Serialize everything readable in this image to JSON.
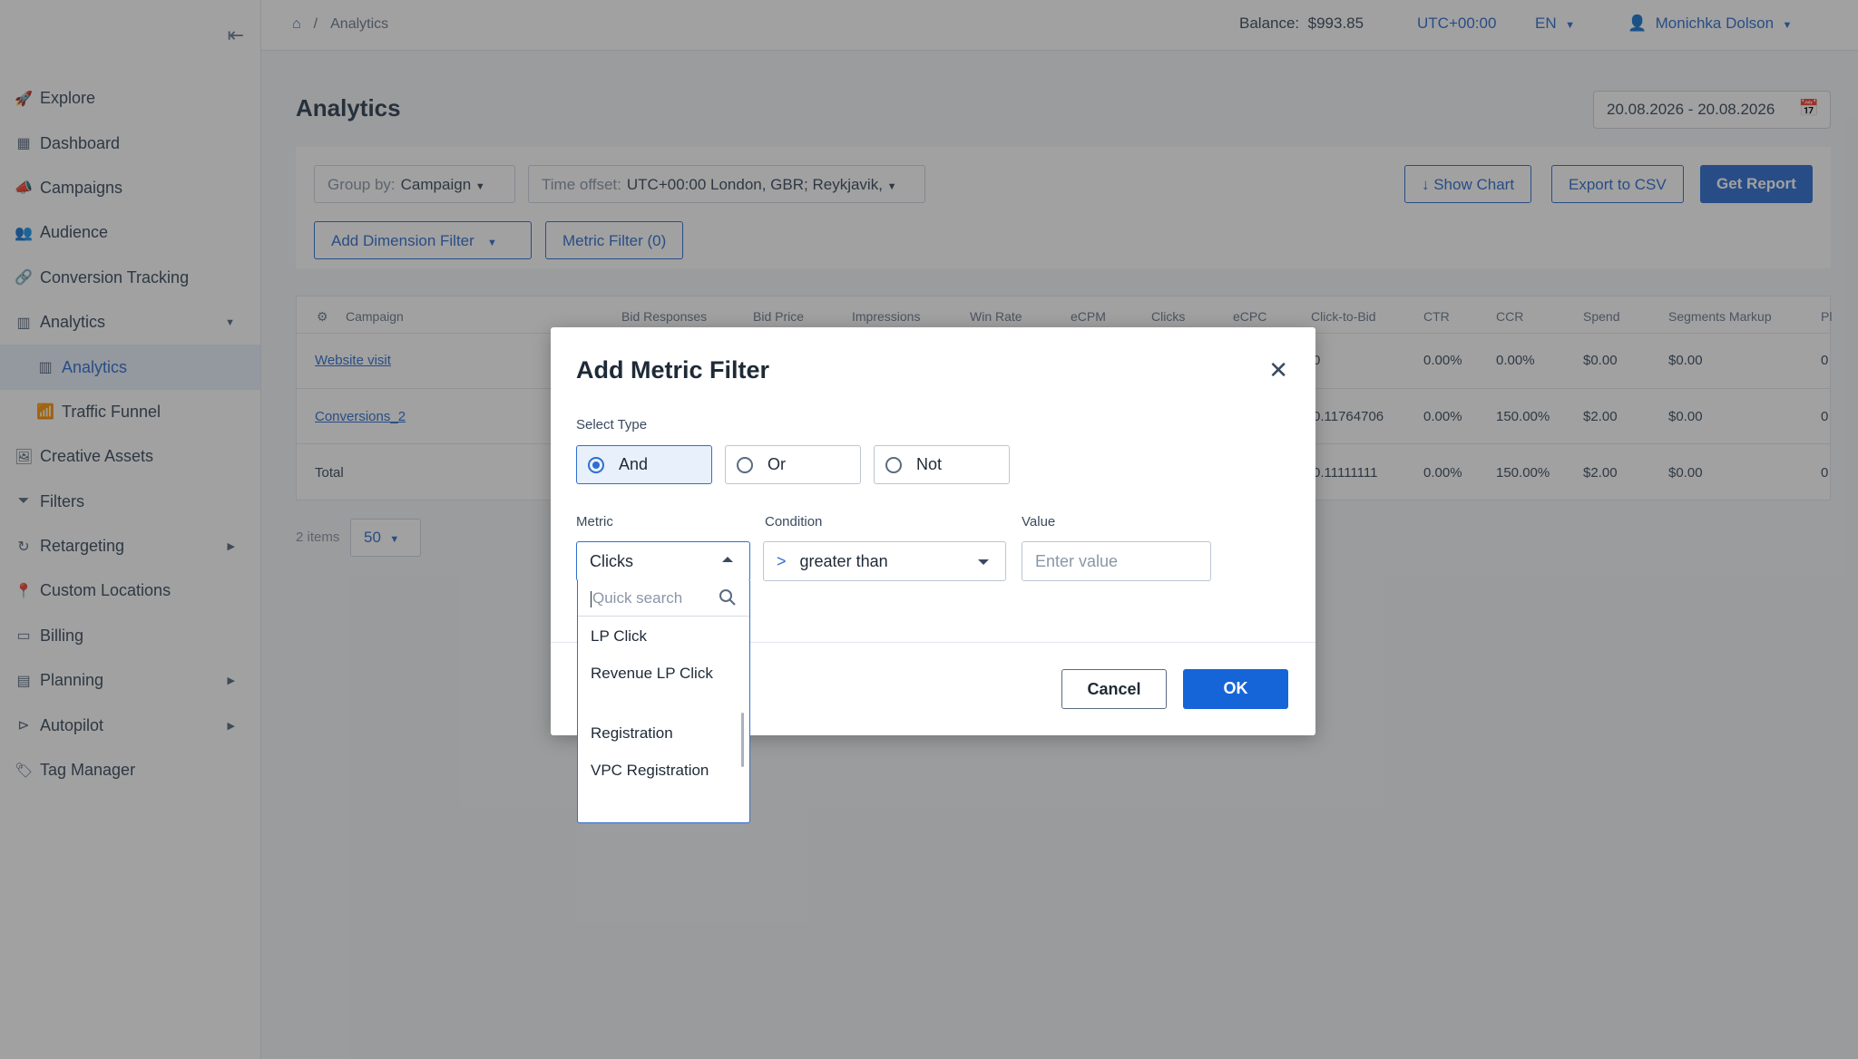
{
  "sidebar": {
    "items": [
      {
        "label": "Explore",
        "icon": "rocket-icon"
      },
      {
        "label": "Dashboard",
        "icon": "dashboard-icon"
      },
      {
        "label": "Campaigns",
        "icon": "megaphone-icon"
      },
      {
        "label": "Audience",
        "icon": "users-icon"
      },
      {
        "label": "Conversion Tracking",
        "icon": "link-icon"
      },
      {
        "label": "Analytics",
        "icon": "chart-icon"
      },
      {
        "label": "Analytics",
        "icon": "chart-icon"
      },
      {
        "label": "Traffic Funnel",
        "icon": "funnel-chart-icon"
      },
      {
        "label": "Creative Assets",
        "icon": "image-icon"
      },
      {
        "label": "Filters",
        "icon": "filter-icon"
      },
      {
        "label": "Retargeting",
        "icon": "refresh-icon"
      },
      {
        "label": "Custom Locations",
        "icon": "location-pin-icon"
      },
      {
        "label": "Billing",
        "icon": "credit-card-icon"
      },
      {
        "label": "Planning",
        "icon": "calendar-icon"
      },
      {
        "label": "Autopilot",
        "icon": "play-circle-icon"
      },
      {
        "label": "Tag Manager",
        "icon": "tag-icon"
      }
    ]
  },
  "topbar": {
    "breadcrumb_sep": "/",
    "breadcrumb_page": "Analytics",
    "balance_label": "Balance:",
    "balance_value": "$993.85",
    "timezone": "UTC+00:00",
    "language": "EN",
    "user_name": "Monichka Dolson"
  },
  "page": {
    "title": "Analytics",
    "date_range": "20.08.2026 - 20.08.2026"
  },
  "toolbar": {
    "group_by_label": "Group by:",
    "group_by_value": "Campaign",
    "time_offset_label": "Time offset:",
    "time_offset_value": "UTC+00:00 London, GBR; Reykjavik,",
    "show_chart": "↓ Show Chart",
    "export_csv": "Export to CSV",
    "get_report": "Get Report",
    "add_dimension_filter": "Add Dimension Filter",
    "metric_filter": "Metric Filter (0)"
  },
  "table": {
    "headers": [
      "Campaign",
      "Bid Responses",
      "Bid Price",
      "Impressions",
      "Win Rate",
      "eCPM",
      "Clicks",
      "eCPC",
      "Click-to-Bid",
      "CTR",
      "CCR",
      "Spend",
      "Segments Markup",
      "Pl"
    ],
    "rows": [
      {
        "campaign": "Website visit",
        "click_to_bid": "0",
        "ctr": "0.00%",
        "ccr": "0.00%",
        "spend": "$0.00",
        "markup": "$0.00",
        "last": "0"
      },
      {
        "campaign": "Conversions_2",
        "click_to_bid": "0.11764706",
        "ctr": "0.00%",
        "ccr": "150.00%",
        "spend": "$2.00",
        "markup": "$0.00",
        "last": "0"
      },
      {
        "campaign": "Total",
        "click_to_bid": "0.11111111",
        "ctr": "0.00%",
        "ccr": "150.00%",
        "spend": "$2.00",
        "markup": "$0.00",
        "last": "0"
      }
    ],
    "items_count": "2 items",
    "page_size": "50"
  },
  "modal": {
    "title": "Add Metric Filter",
    "select_type_label": "Select Type",
    "types": [
      "And",
      "Or",
      "Not"
    ],
    "selected_type": "And",
    "metric_label": "Metric",
    "metric_value": "Clicks",
    "condition_label": "Condition",
    "condition_symbol": ">",
    "condition_value": "greater than",
    "value_label": "Value",
    "value_placeholder": "Enter value",
    "cancel": "Cancel",
    "ok": "OK"
  },
  "metric_dropdown": {
    "search_placeholder": "Quick search",
    "options": [
      "LP Click",
      "Revenue LP Click",
      "Registration",
      "VPC Registration"
    ]
  },
  "colors": {
    "accent": "#2f6fd0",
    "ok_button": "#1565d8",
    "overlay": "rgba(30,30,30,0.42)"
  }
}
